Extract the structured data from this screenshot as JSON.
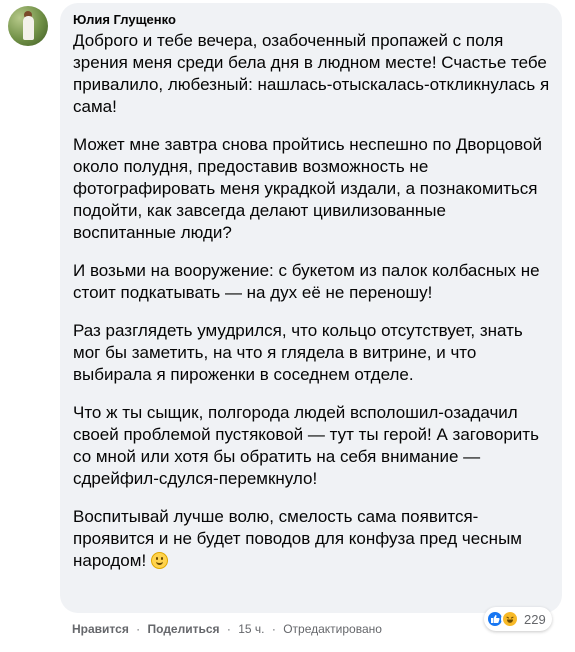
{
  "comment": {
    "author": "Юлия Глущенко",
    "paragraphs": [
      "Доброго и тебе вечера, озабоченный пропажей с поля зрения меня среди бела дня в людном месте! Счастье тебе привалило, любезный: нашлась-отыскалась-откликнулась я сама!",
      "Может мне завтра снова пройтись неспешно по Дворцовой около полудня, предоставив возможность не фотографировать меня украдкой издали, а познакомиться подойти, как завсегда делают цивилизованные воспитанные люди?",
      "И возьми на вооружение: с букетом из палок колбасных не стоит подкатывать — на дух её не переношу!",
      "Раз разглядеть умудрился, что кольцо отсутствует, знать мог бы заметить, на что я глядела в витрине, и что выбирала я пироженки в соседнем отделе.",
      "Что ж ты сыщик, полгорода людей всполошил-озадачил своей проблемой пустяковой — тут ты герой! А заговорить со мной или хотя бы обратить на себя внимание — сдрейфил-сдулся-перемкнуло!",
      "Воспитывай лучше волю, смелость сама появится-проявится и не будет поводов для конфуза пред чесным народом!"
    ],
    "emoji": "smiling-face-emoji",
    "reactions": {
      "icons": [
        "like-icon",
        "haha-icon"
      ],
      "count": "229"
    }
  },
  "actions": {
    "like_label": "Нравится",
    "share_label": "Поделиться",
    "separator": "·",
    "time": "15 ч.",
    "edited": "Отредактировано"
  },
  "colors": {
    "bubble": "#f0f2f5",
    "text": "#050505",
    "meta": "#65676b",
    "like": "#1877f2",
    "haha": "#f7b928"
  }
}
